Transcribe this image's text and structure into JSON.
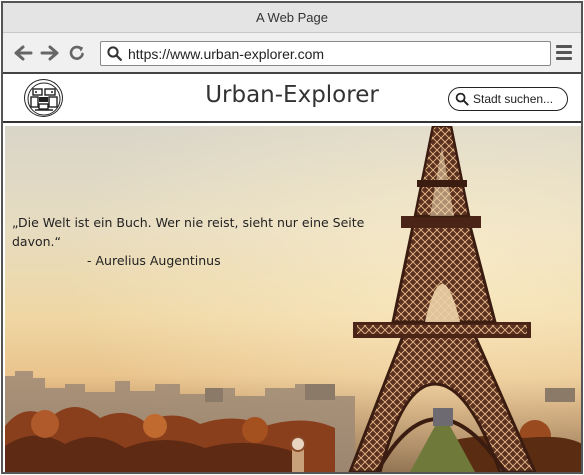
{
  "browser": {
    "window_title": "A Web Page",
    "url": "https://www.urban-explorer.com"
  },
  "site": {
    "title": "Urban-Explorer",
    "search_placeholder": "Stadt suchen..."
  },
  "hero": {
    "quote": "„Die Welt ist ein Buch. Wer nie reist, sieht nur eine Seite davon.“",
    "author": "- Aurelius Augentinus"
  },
  "icons": {
    "back": "back-arrow-icon",
    "forward": "forward-arrow-icon",
    "reload": "reload-icon",
    "search": "search-icon",
    "menu": "hamburger-menu-icon",
    "logo": "urban-explorer-logo"
  }
}
